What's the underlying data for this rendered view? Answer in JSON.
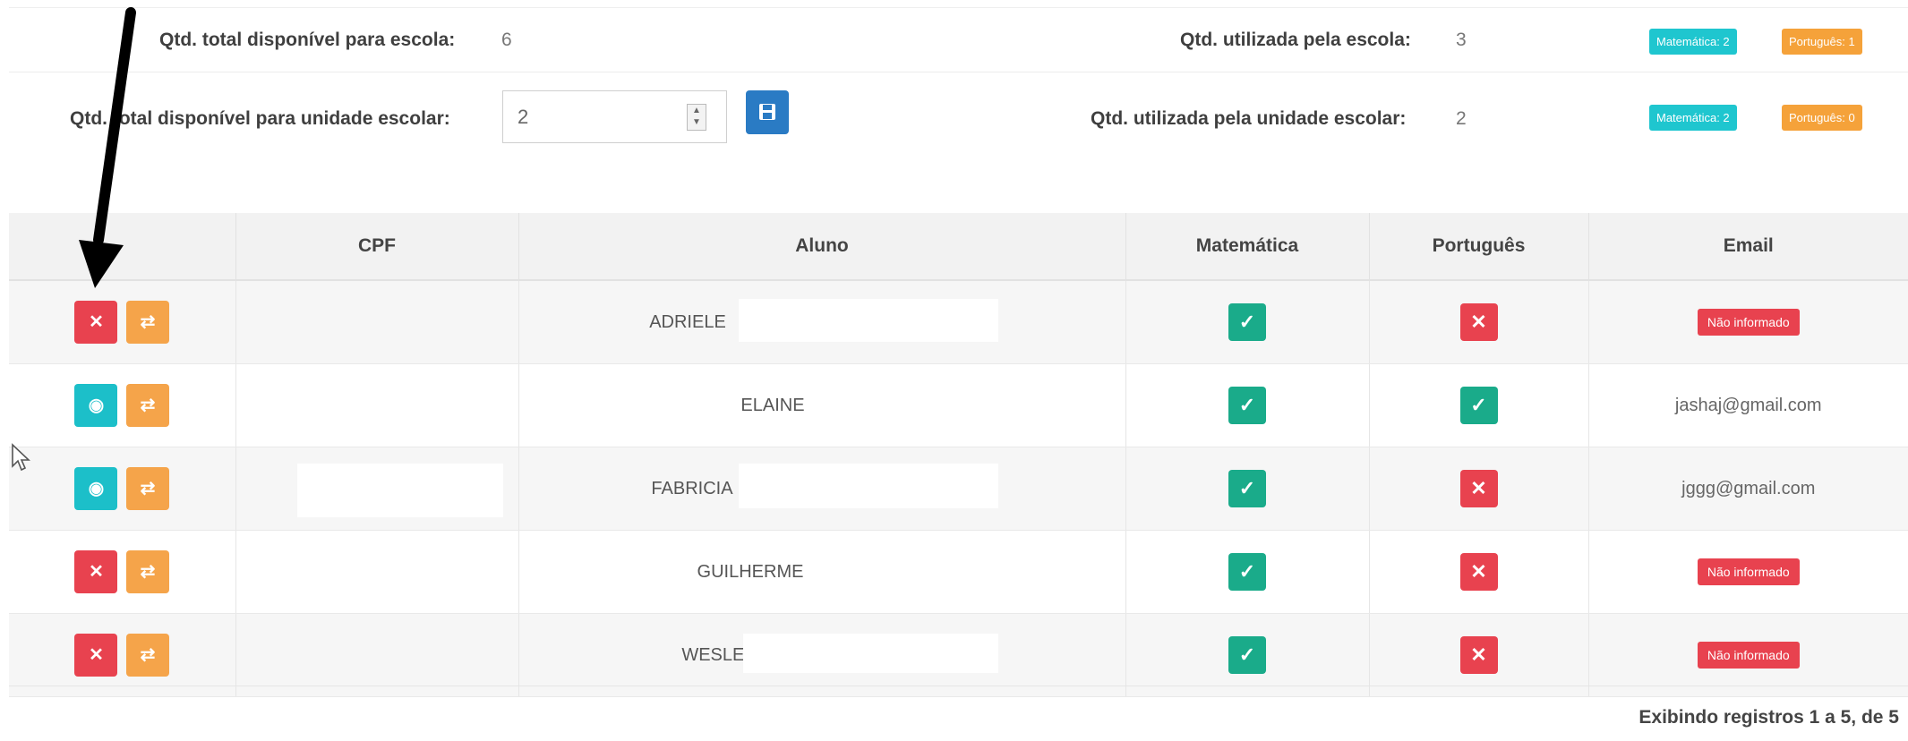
{
  "summary": {
    "school_total_label": "Qtd. total disponível para escola:",
    "school_total_value": "6",
    "school_used_label": "Qtd. utilizada pela escola:",
    "school_used_value": "3",
    "school_badges": [
      "Matemática: 2",
      "Português: 1"
    ],
    "unit_total_label": "Qtd. total disponível para unidade escolar:",
    "unit_total_value": "2",
    "unit_used_label": "Qtd. utilizada pela unidade escolar:",
    "unit_used_value": "2",
    "unit_badges": [
      "Matemática: 2",
      "Português: 0"
    ]
  },
  "table": {
    "headers": [
      "",
      "CPF",
      "Aluno",
      "Matemática",
      "Português",
      "Email"
    ],
    "rows": [
      {
        "primary_action": "remove",
        "cpf": "",
        "aluno": "ADRIELE",
        "matematica": true,
        "portugues": false,
        "email": "Não informado",
        "email_informed": false
      },
      {
        "primary_action": "student",
        "cpf": "",
        "aluno": "ELAINE",
        "matematica": true,
        "portugues": true,
        "email": "jashaj@gmail.com",
        "email_informed": true
      },
      {
        "primary_action": "student",
        "cpf": "",
        "aluno": "FABRICIA",
        "matematica": true,
        "portugues": false,
        "email": "jggg@gmail.com",
        "email_informed": true
      },
      {
        "primary_action": "remove",
        "cpf": "",
        "aluno": "GUILHERME",
        "matematica": true,
        "portugues": false,
        "email": "Não informado",
        "email_informed": false
      },
      {
        "primary_action": "remove",
        "cpf": "",
        "aluno": "WESLEY",
        "matematica": true,
        "portugues": false,
        "email": "Não informado",
        "email_informed": false
      }
    ]
  },
  "footer": {
    "records_text": "Exibindo registros 1 a 5, de 5"
  },
  "colors": {
    "red": "#e8424f",
    "orange": "#f5a44a",
    "cyan": "#1cbfc9",
    "green": "#1aab8a",
    "blue": "#2a7bc4"
  },
  "icons": {
    "remove": "close-icon",
    "student": "user-circle-icon",
    "transfer": "swap-arrows-icon",
    "save": "floppy-disk-icon"
  }
}
